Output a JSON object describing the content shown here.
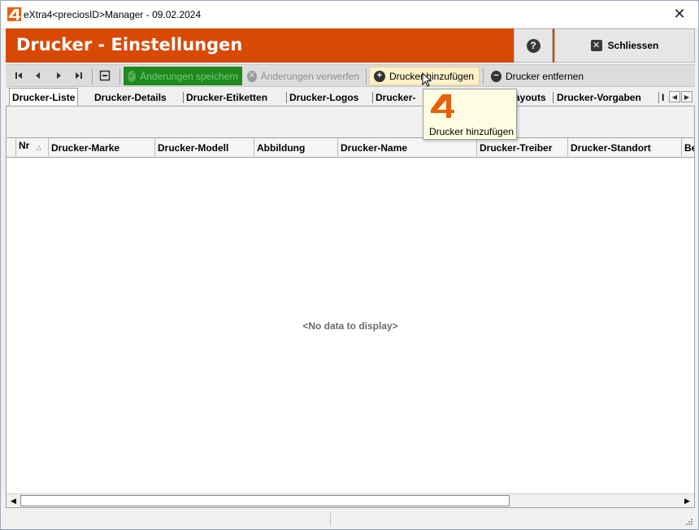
{
  "window": {
    "title": "eXtra4<preciosID>Manager  -  09.02.2024",
    "close_glyph": "✕"
  },
  "header": {
    "title": "Drucker - Einstellungen",
    "help_label": "?",
    "close_label": "Schliessen"
  },
  "toolbar": {
    "save_label": "Änderungen speichern",
    "discard_label": "Änderungen verwerfen",
    "add_label": "Drucker hinzufügen",
    "remove_label": "Drucker entfernen"
  },
  "tabs": [
    {
      "label": "Drucker-Liste",
      "active": true
    },
    {
      "label": "Drucker-Details"
    },
    {
      "label": "Drucker-Etiketten"
    },
    {
      "label": "Drucker-Logos"
    },
    {
      "label": "Drucker-"
    },
    {
      "label": "ayouts"
    },
    {
      "label": "Drucker-Vorgaben"
    },
    {
      "label": "I"
    }
  ],
  "grid": {
    "columns": [
      "Nr",
      "Drucker-Marke",
      "Drucker-Modell",
      "Abbildung",
      "Drucker-Name",
      "Drucker-Treiber",
      "Drucker-Standort",
      "Be"
    ],
    "empty_text": "<No data to display>"
  },
  "tooltip": {
    "text": "Drucker hinzufügen"
  },
  "colors": {
    "brand_orange": "#d84a04",
    "save_green": "#1e8a1e",
    "tooltip_bg": "#fffde1"
  }
}
